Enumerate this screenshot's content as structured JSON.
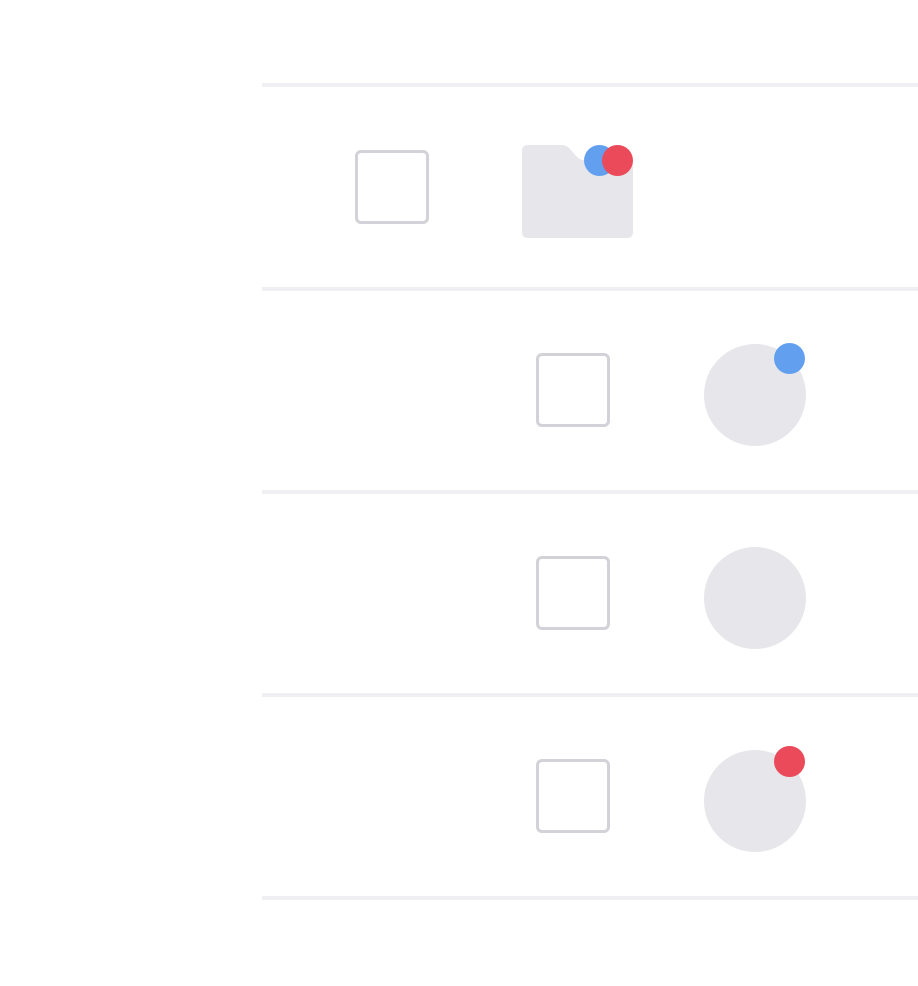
{
  "colors": {
    "divider": "#efeff4",
    "checkbox_border": "#d2d2d8",
    "placeholder_fill": "#e6e6eb",
    "blue_indicator": "#62a0ef",
    "red_indicator": "#ea4a5a"
  },
  "rows": [
    {
      "kind": "folder",
      "icon": "folder-icon",
      "checked": false,
      "indicators": [
        "blue",
        "red"
      ]
    },
    {
      "kind": "item",
      "icon": "avatar-placeholder",
      "checked": false,
      "indicators": [
        "blue"
      ]
    },
    {
      "kind": "item",
      "icon": "avatar-placeholder",
      "checked": false,
      "indicators": []
    },
    {
      "kind": "item",
      "icon": "avatar-placeholder",
      "checked": false,
      "indicators": [
        "red"
      ]
    }
  ]
}
